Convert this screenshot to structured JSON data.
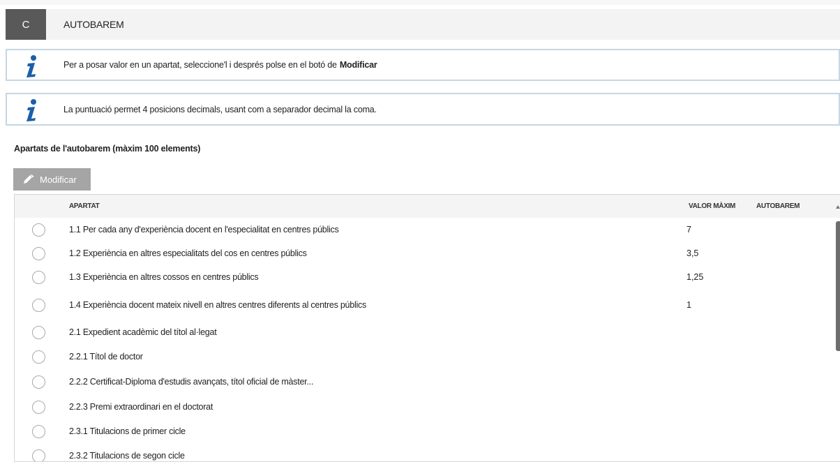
{
  "section": {
    "letter": "C",
    "title": "AUTOBAREM"
  },
  "info": [
    {
      "text": "Per a posar valor en un apartat, seleccione'l i després polse en el botó de",
      "bold": "Modificar"
    },
    {
      "text": "La puntuació permet 4 posicions decimals, usant com a separador decimal la coma.",
      "bold": ""
    }
  ],
  "list_title": "Apartats de l'autobarem (màxim 100 elements)",
  "toolbar": {
    "modify_label": "Modificar",
    "modify_icon": "pencil-icon"
  },
  "table": {
    "headers": {
      "apartat": "APARTAT",
      "valor": "VALOR MÀXIM",
      "autobarem": "AUTOBAREM"
    },
    "rows": [
      {
        "apartat": "1.1 Per cada any d'experiència docent en l'especialitat en centres públics",
        "valor": "7",
        "autobarem": ""
      },
      {
        "apartat": "1.2 Experiència en altres especialitats del cos en centres públics",
        "valor": "3,5",
        "autobarem": ""
      },
      {
        "apartat": "1.3 Experiència en altres cossos en centres públics",
        "valor": "1,25",
        "autobarem": ""
      },
      {
        "apartat": "1.4 Experiència docent mateix nivell en altres centres diferents al centres públics",
        "valor": "1",
        "autobarem": ""
      },
      {
        "apartat": "2.1 Expedient acadèmic del títol al·legat",
        "valor": "",
        "autobarem": ""
      },
      {
        "apartat": "2.2.1 Títol de doctor",
        "valor": "",
        "autobarem": ""
      },
      {
        "apartat": "2.2.2 Certificat-Diploma d'estudis avançats, títol oficial de màster...",
        "valor": "",
        "autobarem": ""
      },
      {
        "apartat": "2.2.3 Premi extraordinari en el doctorat",
        "valor": "",
        "autobarem": ""
      },
      {
        "apartat": "2.3.1 Titulacions de primer cicle",
        "valor": "",
        "autobarem": ""
      },
      {
        "apartat": "2.3.2 Titulacions de segon cicle",
        "valor": "",
        "autobarem": ""
      }
    ]
  },
  "colors": {
    "accent_blue": "#1b5faa",
    "header_dark": "#595959",
    "button_gray": "#a5a5a5",
    "info_border": "#c5d7e4"
  }
}
